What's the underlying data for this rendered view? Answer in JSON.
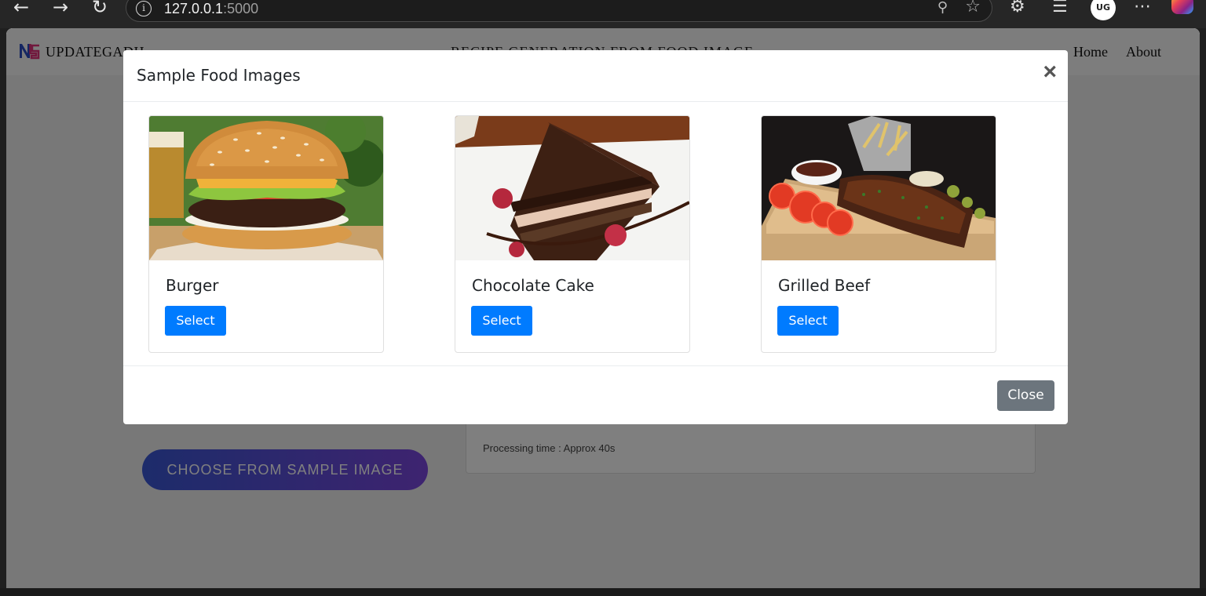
{
  "browser": {
    "url_host": "127.0.0.1",
    "url_port": ":5000",
    "profile_initials": "UG"
  },
  "site": {
    "brand": "UPDATEGADH",
    "title": "RECIPE GENERATION FROM FOOD IMAGE",
    "nav": [
      "Home",
      "About"
    ],
    "sample_button": "CHOOSE FROM SAMPLE IMAGE",
    "processing_time": "Processing time : Approx 40s"
  },
  "modal": {
    "title": "Sample Food Images",
    "close_x": "×",
    "items": [
      {
        "name": "Burger",
        "select_label": "Select"
      },
      {
        "name": "Chocolate Cake",
        "select_label": "Select"
      },
      {
        "name": "Grilled Beef",
        "select_label": "Select"
      }
    ],
    "close_label": "Close"
  },
  "colors": {
    "primary": "#007bff",
    "secondary": "#6c757d",
    "gradient_start": "#3a58d6",
    "gradient_end": "#7c47e0"
  }
}
